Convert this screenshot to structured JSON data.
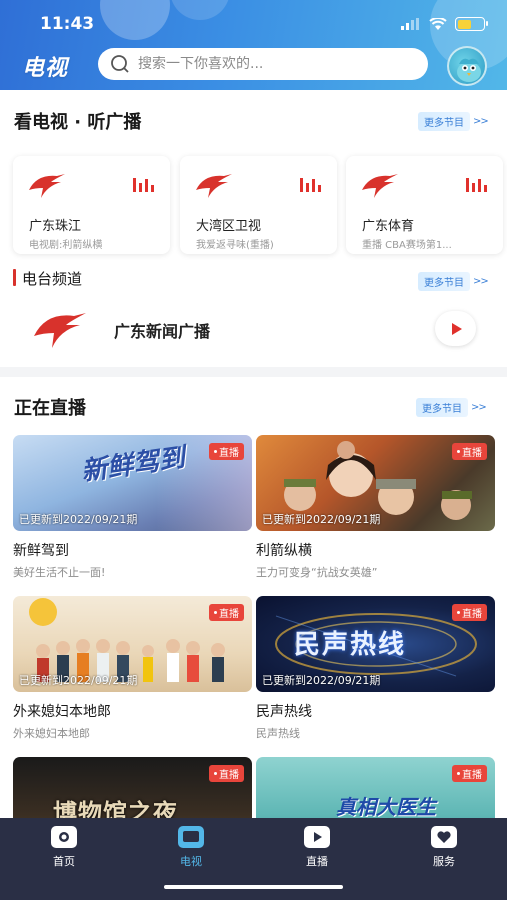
{
  "status_bar": {
    "time": "11:43"
  },
  "header": {
    "app_title": "电视",
    "search_placeholder": "搜索一下你喜欢的..."
  },
  "tv_section": {
    "title": "看电视 · 听广播",
    "more_label": "更多节目",
    "more_arrow": ">>",
    "channels": [
      {
        "name": "广东珠江",
        "sub": "电视剧:利箭纵横"
      },
      {
        "name": "大湾区卫视",
        "sub": "我爱返寻味(重播)"
      },
      {
        "name": "广东体育",
        "sub": "重播 CBA赛场第1..."
      }
    ]
  },
  "radio_section": {
    "title": "电台频道",
    "more_label": "更多节目",
    "more_arrow": ">>",
    "station_name": "广东新闻广播"
  },
  "live_section": {
    "title": "正在直播",
    "more_label": "更多节目",
    "more_arrow": ">>",
    "cards": [
      {
        "badge": "直播",
        "updated": "已更新到2022/09/21期",
        "title": "新鲜驾到",
        "sub": "美好生活不止一面!",
        "art_text": "新鲜驾到"
      },
      {
        "badge": "直播",
        "updated": "已更新到2022/09/21期",
        "title": "利箭纵横",
        "sub": "王力可变身“抗战女英雄”",
        "art_text": ""
      },
      {
        "badge": "直播",
        "updated": "已更新到2022/09/21期",
        "title": "外来媳妇本地郎",
        "sub": "外来媳妇本地郎",
        "art_text": "外来媳妇本地郎"
      },
      {
        "badge": "直播",
        "updated": "已更新到2022/09/21期",
        "title": "民声热线",
        "sub": "民声热线",
        "art_text": "民声热线"
      },
      {
        "badge": "直播",
        "art_text": "博物馆之夜"
      },
      {
        "badge": "直播",
        "art_text": "真相大医生"
      }
    ]
  },
  "bottom_nav": {
    "items": [
      {
        "label": "首页",
        "icon": "home-icon"
      },
      {
        "label": "电视",
        "icon": "tv-icon"
      },
      {
        "label": "直播",
        "icon": "live-play-icon"
      },
      {
        "label": "服务",
        "icon": "service-heart-icon"
      }
    ],
    "active_index": 1
  },
  "colors": {
    "brand_blue": "#3b8fe4",
    "live_red": "#e8453b",
    "nav_bg": "#2a2f45",
    "nav_active": "#53b7e8"
  }
}
